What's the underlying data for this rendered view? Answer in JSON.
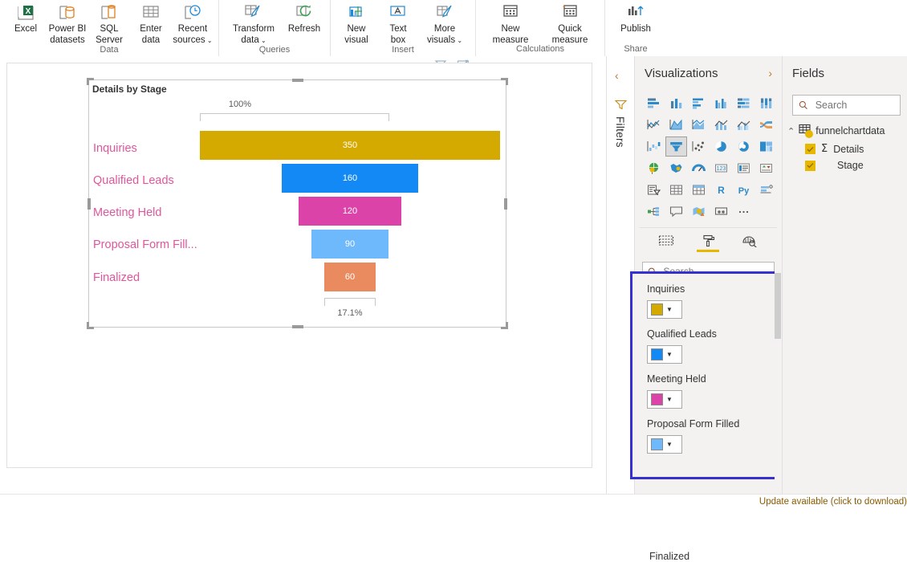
{
  "ribbon": {
    "groups": [
      {
        "label": "Data",
        "buttons": [
          {
            "name": "excel",
            "icon": "excel-icon",
            "lines": [
              "Excel"
            ]
          },
          {
            "name": "powerbi-datasets",
            "icon": "powerbi-datasets-icon",
            "lines": [
              "Power BI",
              "datasets"
            ]
          },
          {
            "name": "sql-server",
            "icon": "sql-server-icon",
            "lines": [
              "SQL",
              "Server"
            ]
          },
          {
            "name": "enter-data",
            "icon": "enter-data-icon",
            "lines": [
              "Enter",
              "data"
            ]
          },
          {
            "name": "recent-sources",
            "icon": "recent-sources-icon",
            "lines": [
              "Recent",
              "sources"
            ],
            "caret": true
          }
        ]
      },
      {
        "label": "Queries",
        "buttons": [
          {
            "name": "transform-data",
            "icon": "transform-data-icon",
            "lines": [
              "Transform",
              "data"
            ],
            "caret": true
          },
          {
            "name": "refresh",
            "icon": "refresh-icon",
            "lines": [
              "Refresh"
            ]
          }
        ]
      },
      {
        "label": "Insert",
        "buttons": [
          {
            "name": "new-visual",
            "icon": "new-visual-icon",
            "lines": [
              "New",
              "visual"
            ]
          },
          {
            "name": "text-box",
            "icon": "text-box-icon",
            "lines": [
              "Text",
              "box"
            ]
          },
          {
            "name": "more-visuals",
            "icon": "more-visuals-icon",
            "lines": [
              "More",
              "visuals"
            ],
            "caret": true
          }
        ]
      },
      {
        "label": "Calculations",
        "buttons": [
          {
            "name": "new-measure",
            "icon": "new-measure-icon",
            "lines": [
              "New",
              "measure"
            ]
          },
          {
            "name": "quick-measure",
            "icon": "quick-measure-icon",
            "lines": [
              "Quick",
              "measure"
            ]
          }
        ]
      },
      {
        "label": "Share",
        "buttons": [
          {
            "name": "publish",
            "icon": "publish-icon",
            "lines": [
              "Publish"
            ]
          }
        ]
      }
    ]
  },
  "canvas": {
    "visual_actions": [
      {
        "name": "filter-icon",
        "title": "Filters"
      },
      {
        "name": "focus-mode-icon",
        "title": "Focus mode"
      },
      {
        "name": "more-options-icon",
        "title": "More options"
      }
    ],
    "visual_title": "Details by Stage"
  },
  "chart_data": {
    "type": "bar",
    "title": "Details by Stage",
    "categories": [
      "Inquiries",
      "Qualified Leads",
      "Meeting Held",
      "Proposal Form Fill...",
      "Finalized"
    ],
    "values": [
      350,
      160,
      120,
      90,
      60
    ],
    "value_labels": [
      "350",
      "160",
      "120",
      "90",
      "60"
    ],
    "colors": [
      "#D4AA00",
      "#1389F5",
      "#DC43A8",
      "#6EB9FB",
      "#E98B5F"
    ],
    "top_percent_label": "100%",
    "bottom_percent_label": "17.1%",
    "xlabel": "",
    "ylabel": "",
    "legend": "none",
    "grid": false
  },
  "filters_rail": {
    "collapse_icon": "chevron-left-icon",
    "funnel_icon": "filter-funnel-icon",
    "label": "Filters"
  },
  "visualizations": {
    "title": "Visualizations",
    "expand_icon": "chevron-right-icon",
    "icons": [
      {
        "name": "stacked-bar-chart-icon",
        "selected": false
      },
      {
        "name": "stacked-column-chart-icon",
        "selected": false
      },
      {
        "name": "clustered-bar-chart-icon",
        "selected": false
      },
      {
        "name": "clustered-column-chart-icon",
        "selected": false
      },
      {
        "name": "100-stacked-bar-chart-icon",
        "selected": false
      },
      {
        "name": "100-stacked-column-chart-icon",
        "selected": false
      },
      {
        "name": "line-chart-icon",
        "selected": false
      },
      {
        "name": "area-chart-icon",
        "selected": false
      },
      {
        "name": "stacked-area-chart-icon",
        "selected": false
      },
      {
        "name": "line-stacked-column-chart-icon",
        "selected": false
      },
      {
        "name": "line-clustered-column-chart-icon",
        "selected": false
      },
      {
        "name": "ribbon-chart-icon",
        "selected": false
      },
      {
        "name": "waterfall-chart-icon",
        "selected": false
      },
      {
        "name": "funnel-chart-icon",
        "selected": true
      },
      {
        "name": "scatter-chart-icon",
        "selected": false
      },
      {
        "name": "pie-chart-icon",
        "selected": false
      },
      {
        "name": "donut-chart-icon",
        "selected": false
      },
      {
        "name": "treemap-icon",
        "selected": false
      },
      {
        "name": "map-icon",
        "selected": false
      },
      {
        "name": "filled-map-icon",
        "selected": false
      },
      {
        "name": "gauge-icon",
        "selected": false
      },
      {
        "name": "card-icon",
        "selected": false
      },
      {
        "name": "multi-row-card-icon",
        "selected": false
      },
      {
        "name": "kpi-icon",
        "selected": false
      },
      {
        "name": "slicer-icon",
        "selected": false
      },
      {
        "name": "table-icon",
        "selected": false
      },
      {
        "name": "matrix-icon",
        "selected": false
      },
      {
        "name": "r-script-visual-icon",
        "selected": false
      },
      {
        "name": "python-visual-icon",
        "selected": false
      },
      {
        "name": "key-influencers-icon",
        "selected": false
      },
      {
        "name": "decomposition-tree-icon",
        "selected": false
      },
      {
        "name": "qa-visual-icon",
        "selected": false
      },
      {
        "name": "arcgis-map-icon",
        "selected": false
      },
      {
        "name": "paginated-report-icon",
        "selected": false
      },
      {
        "name": "more-visuals-ellipsis-icon",
        "selected": false
      }
    ],
    "tabs": [
      {
        "name": "fields-tab",
        "icon": "fields-grid-icon",
        "active": false
      },
      {
        "name": "format-tab",
        "icon": "paint-roller-icon",
        "active": true
      },
      {
        "name": "analytics-tab",
        "icon": "magnifier-chart-icon",
        "active": false
      }
    ],
    "search": {
      "placeholder": "Search",
      "value": "",
      "icon": "search-icon"
    },
    "color_rows": [
      {
        "label": "Inquiries",
        "color": "#D4AA00"
      },
      {
        "label": "Qualified Leads",
        "color": "#1389F5"
      },
      {
        "label": "Meeting Held",
        "color": "#DC43A8"
      },
      {
        "label": "Proposal Form Filled",
        "color": "#6EB9FB"
      }
    ],
    "partial_row_label": "Finalized",
    "highlight_color": "#3730d0"
  },
  "fields": {
    "title": "Fields",
    "search": {
      "placeholder": "Search",
      "value": "",
      "icon": "search-icon"
    },
    "table": {
      "name": "funnelchartdata",
      "expand_icon": "chevron-up-icon",
      "table-icon": "table-icon"
    },
    "items": [
      {
        "label": "Details",
        "checked": true,
        "measure": true,
        "sigma": "Σ"
      },
      {
        "label": "Stage",
        "checked": true,
        "measure": false,
        "sigma": ""
      }
    ]
  },
  "statusbar": {
    "update_message": "Update available (click to download)"
  }
}
